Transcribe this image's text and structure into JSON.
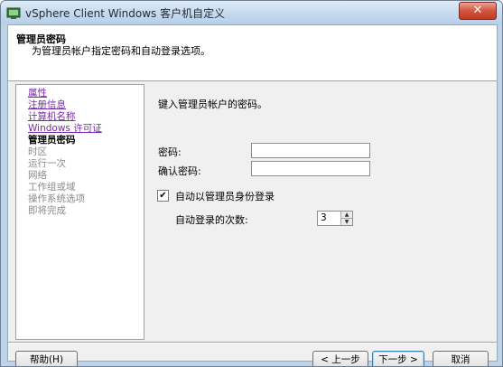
{
  "window": {
    "title": "vSphere Client Windows 客户机自定义",
    "close_glyph": "✕"
  },
  "header": {
    "title": "管理员密码",
    "description": "为管理员帐户指定密码和自动登录选项。"
  },
  "nav": {
    "items": [
      {
        "label": "属性",
        "state": "link"
      },
      {
        "label": "注册信息",
        "state": "link"
      },
      {
        "label": "计算机名称",
        "state": "link"
      },
      {
        "label": "Windows 许可证",
        "state": "link"
      },
      {
        "label": "管理员密码",
        "state": "current"
      },
      {
        "label": "时区",
        "state": "pending"
      },
      {
        "label": "运行一次",
        "state": "pending"
      },
      {
        "label": "网络",
        "state": "pending"
      },
      {
        "label": "工作组或域",
        "state": "pending"
      },
      {
        "label": "操作系统选项",
        "state": "pending"
      },
      {
        "label": "即将完成",
        "state": "pending"
      }
    ]
  },
  "form": {
    "prompt": "键入管理员帐户的密码。",
    "password_label": "密码:",
    "password_value": "",
    "confirm_label": "确认密码:",
    "confirm_value": "",
    "autologon_label": "自动以管理员身份登录",
    "autologon_checked": true,
    "check_glyph": "✔",
    "count_label": "自动登录的次数:",
    "count_value": "3"
  },
  "buttons": {
    "help": "帮助(H)",
    "back": "< 上一步",
    "next": "下一步 >",
    "cancel": "取消"
  }
}
